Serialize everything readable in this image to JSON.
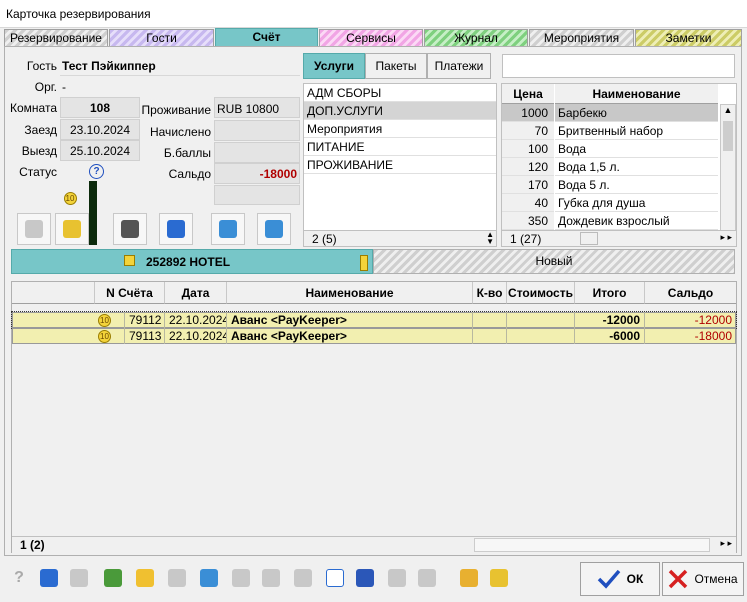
{
  "window": {
    "title": "Карточка резервирования"
  },
  "tabs": [
    "Резервирование",
    "Гости",
    "Счёт",
    "Сервисы",
    "Журнал",
    "Мероприятия",
    "Заметки"
  ],
  "guest": {
    "guest_label": "Гость",
    "guest_value": "Тест Пэйкиппер",
    "org_label": "Орг.",
    "org_value": "-",
    "room_label": "Комната",
    "room_value": "108",
    "checkin_label": "Заезд",
    "checkin_value": "23.10.2024",
    "checkout_label": "Выезд",
    "checkout_value": "25.10.2024",
    "status_label": "Статус",
    "status_icon": "?",
    "stay_label": "Проживание",
    "stay_value": "RUB 10800",
    "accrued_label": "Начислено",
    "bonus_label": "Б.баллы",
    "balance_label": "Сальдо",
    "balance_value": "-18000"
  },
  "service_tabs": [
    "Услуги",
    "Пакеты",
    "Платежи"
  ],
  "categories": {
    "items": [
      "АДМ СБОРЫ",
      "ДОП.УСЛУГИ",
      "Мероприятия",
      "ПИТАНИЕ",
      "ПРОЖИВАНИЕ"
    ],
    "selected": "ДОП.УСЛУГИ",
    "counter": "2 (5)"
  },
  "prices": {
    "price_header": "Цена",
    "name_header": "Наименование",
    "rows": [
      {
        "price": "1000",
        "name": "Барбекю"
      },
      {
        "price": "70",
        "name": "Бритвенный набор"
      },
      {
        "price": "100",
        "name": "Вода"
      },
      {
        "price": "120",
        "name": "Вода 1,5 л."
      },
      {
        "price": "170",
        "name": "Вода 5 л."
      },
      {
        "price": "40",
        "name": "Губка для душа"
      },
      {
        "price": "350",
        "name": "Дождевик взрослый"
      }
    ],
    "counter": "1 (27)"
  },
  "account_tabs": {
    "active": "252892  HOTEL",
    "new": "Новый"
  },
  "account_grid": {
    "headers": [
      "N Счёта",
      "Дата",
      "Наименование",
      "К-во",
      "Стоимость",
      "Итого",
      "Сальдо"
    ],
    "rows": [
      {
        "coin": "10",
        "number": "79112",
        "date": "22.10.2024",
        "name": "Аванс <PayKeeper>",
        "qty": "",
        "cost": "",
        "total": "-12000",
        "balance": "-12000"
      },
      {
        "coin": "10",
        "number": "79113",
        "date": "22.10.2024",
        "name": "Аванс <PayKeeper>",
        "qty": "",
        "cost": "",
        "total": "-6000",
        "balance": "-18000"
      }
    ],
    "counter": "1 (2)"
  },
  "buttons": {
    "ok": "ОК",
    "cancel": "Отмена"
  },
  "colors": {
    "tab_active": "#77c6c8",
    "row_highlight": "#f2efb0",
    "negative": "#b00000",
    "ok_check": "#1f4fbf",
    "cancel_x": "#d62020"
  }
}
